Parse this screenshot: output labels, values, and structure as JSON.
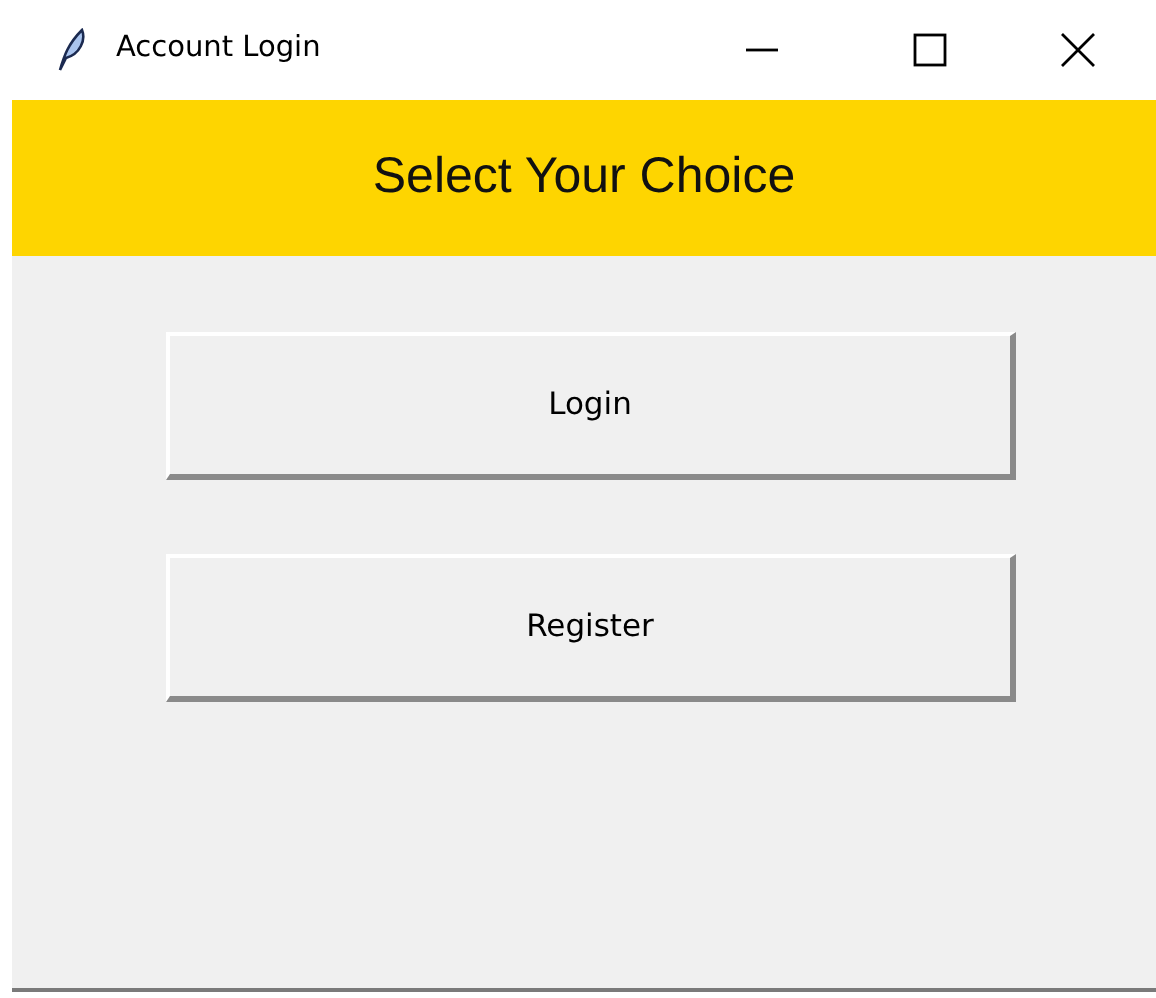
{
  "window": {
    "title": "Account Login"
  },
  "header": {
    "title": "Select Your Choice"
  },
  "buttons": [
    {
      "label": "Login"
    },
    {
      "label": "Register"
    }
  ]
}
